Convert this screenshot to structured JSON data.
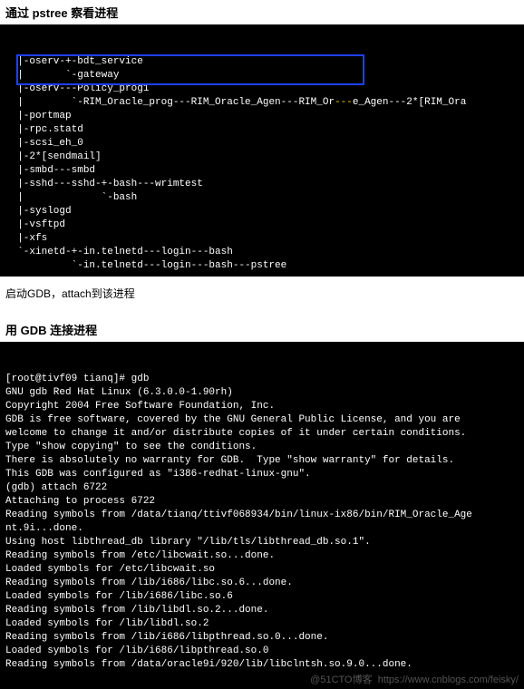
{
  "section1": {
    "title": "通过 pstree 察看进程",
    "lines": [
      "|-oserv-+-bdt_service",
      "|       `-gateway",
      "|-oserv---Policy_prog1",
      "|        `-RIM_Oracle_prog---RIM_Oracle_Agen---RIM_Oracle_Agen---2*[RIM_Ora",
      "|-portmap",
      "|-rpc.statd",
      "|-scsi_eh_0",
      "|-2*[sendmail]",
      "|-smbd---smbd",
      "|-sshd---sshd-+-bash---wrimtest",
      "|             `-bash",
      "|-syslogd",
      "|-vsftpd",
      "|-xfs",
      "`-xinetd-+-in.telnetd---login---bash",
      "         `-in.telnetd---login---bash---pstree"
    ]
  },
  "caption1": "启动GDB，attach到该进程",
  "section2": {
    "title": "用 GDB 连接进程",
    "lines": [
      "[root@tivf09 tianq]# gdb",
      "GNU gdb Red Hat Linux (6.3.0.0-1.90rh)",
      "Copyright 2004 Free Software Foundation, Inc.",
      "GDB is free software, covered by the GNU General Public License, and you are",
      "welcome to change it and/or distribute copies of it under certain conditions.",
      "Type \"show copying\" to see the conditions.",
      "There is absolutely no warranty for GDB.  Type \"show warranty\" for details.",
      "This GDB was configured as \"i386-redhat-linux-gnu\".",
      "(gdb) attach 6722",
      "Attaching to process 6722",
      "Reading symbols from /data/tianq/ttivf068934/bin/linux-ix86/bin/RIM_Oracle_Age",
      "nt.9i...done.",
      "Using host libthread_db library \"/lib/tls/libthread_db.so.1\".",
      "Reading symbols from /etc/libcwait.so...done.",
      "Loaded symbols for /etc/libcwait.so",
      "Reading symbols from /lib/i686/libc.so.6...done.",
      "Loaded symbols for /lib/i686/libc.so.6",
      "Reading symbols from /lib/libdl.so.2...done.",
      "Loaded symbols for /lib/libdl.so.2",
      "Reading symbols from /lib/i686/libpthread.so.0...done.",
      "Loaded symbols for /lib/i686/libpthread.so.0",
      "Reading symbols from /data/oracle9i/920/lib/libclntsh.so.9.0...done."
    ],
    "watermark": "@51CTO博客  https://www.cnblogs.com/feisky/"
  }
}
